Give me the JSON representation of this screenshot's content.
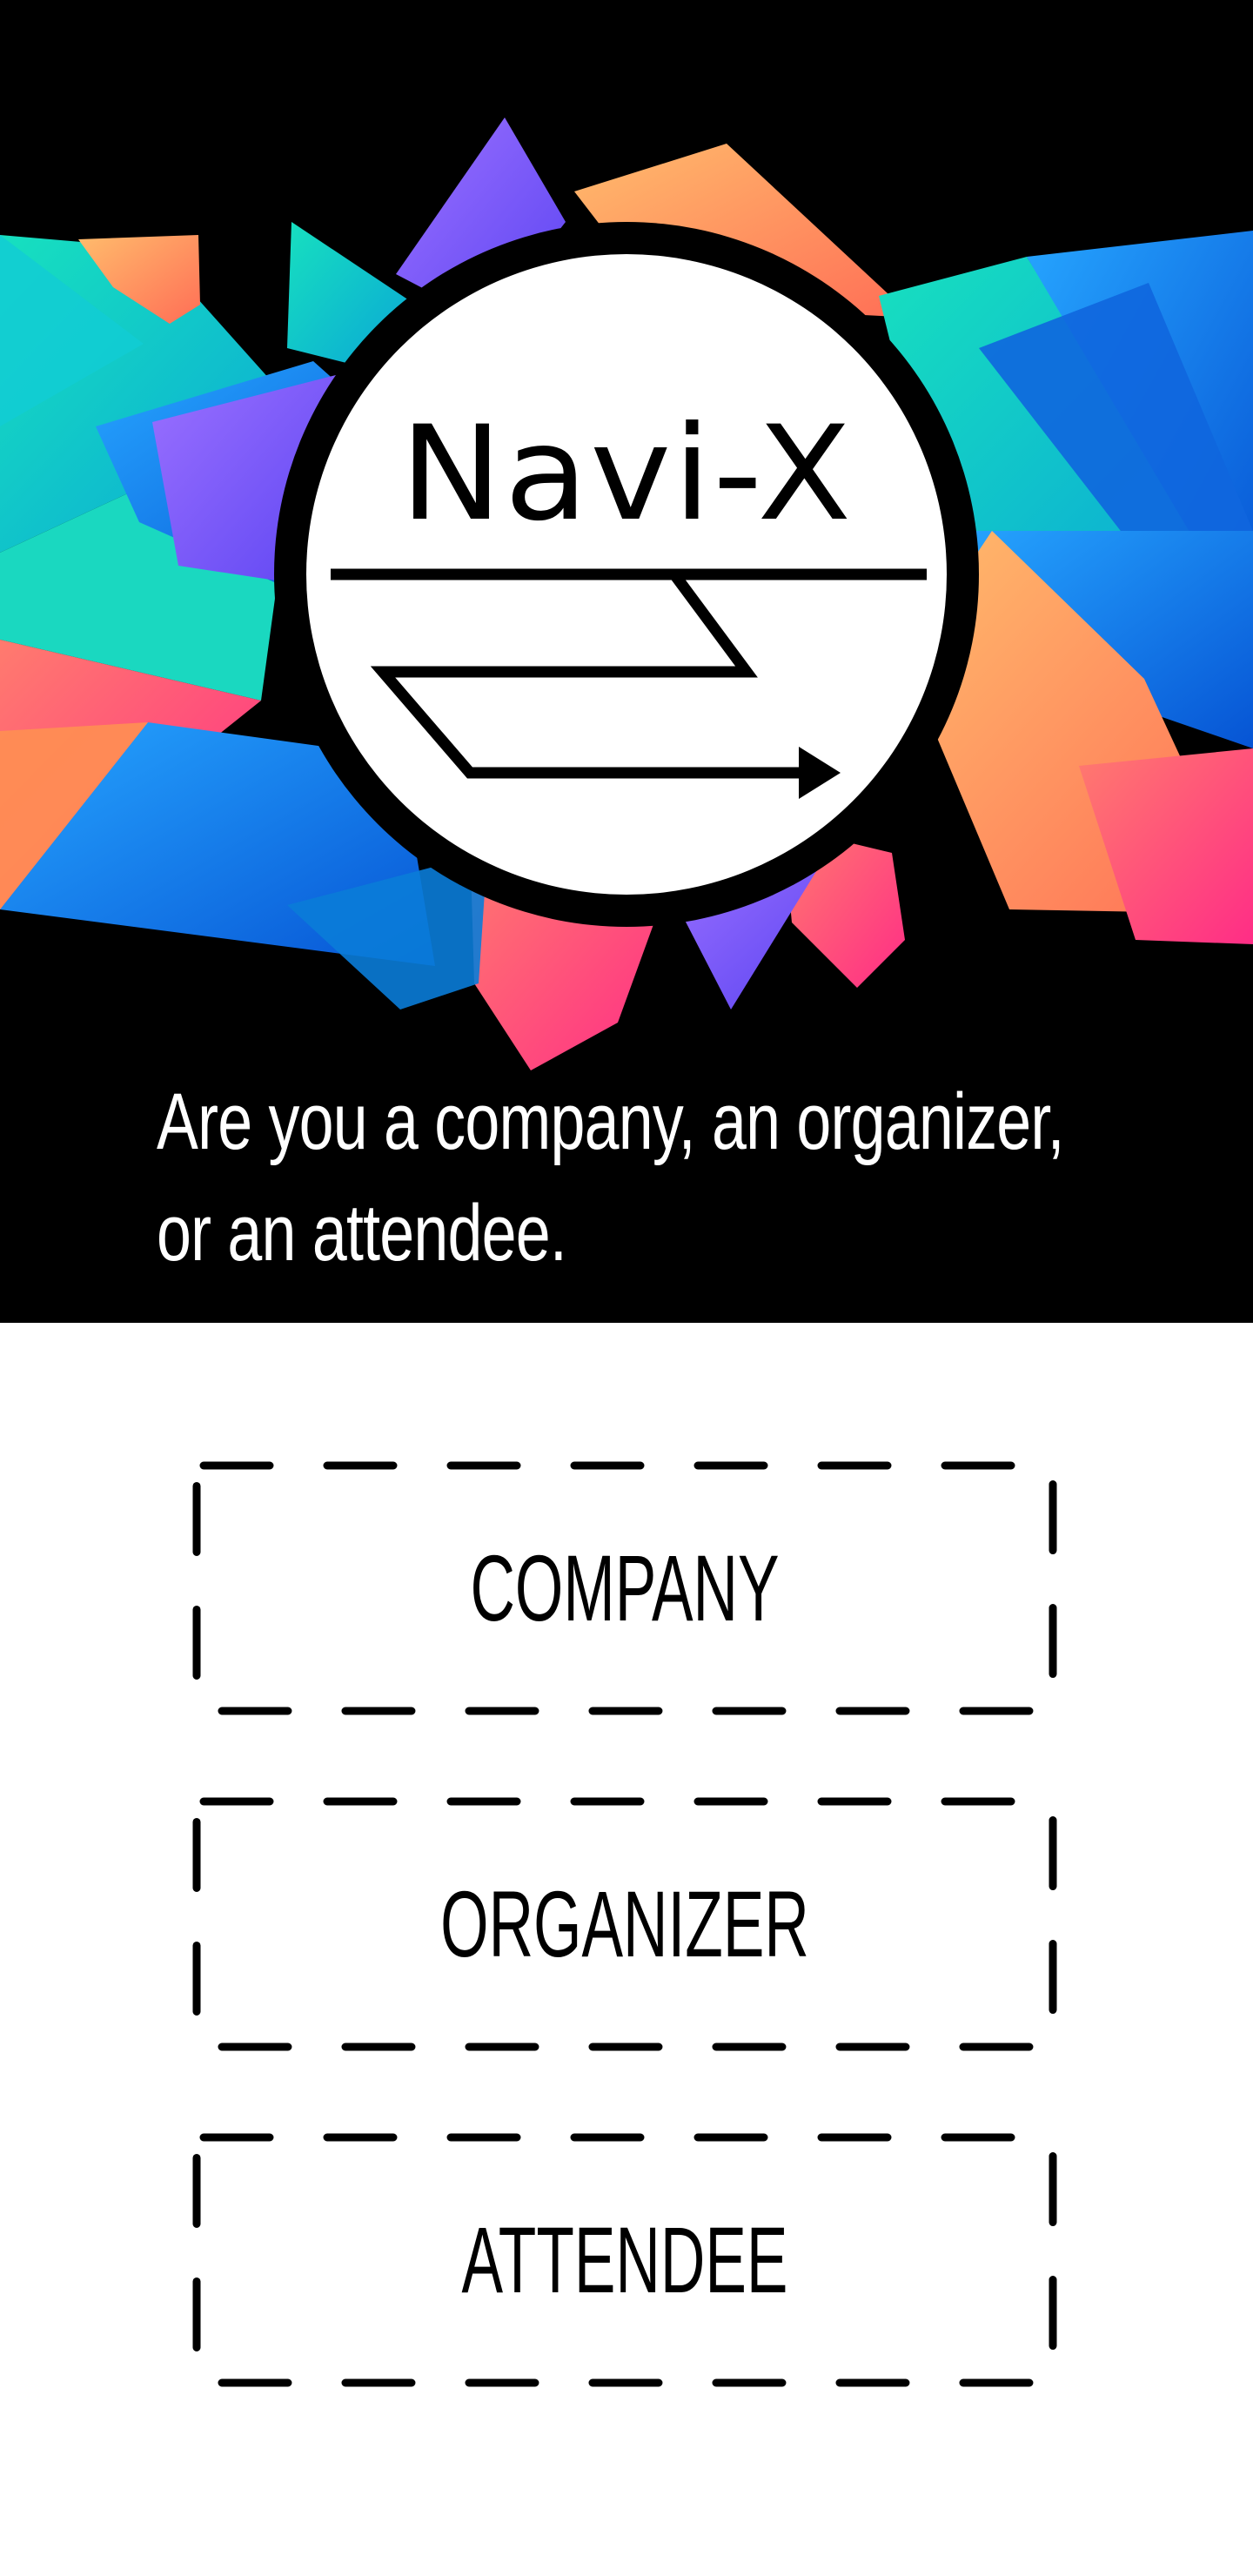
{
  "logo": {
    "text": "Navi-X",
    "icon": "navigation-route-arrow-icon"
  },
  "header": {
    "prompt": "Are you a company, an organizer, or an attendee."
  },
  "choices": [
    {
      "label": "COMPANY"
    },
    {
      "label": "ORGANIZER"
    },
    {
      "label": "ATTENDEE"
    }
  ],
  "colors": {
    "hero_background": "#000000",
    "page_background": "#ffffff",
    "text_light": "#ffffff",
    "text_dark": "#000000",
    "teal": "#14d9c3",
    "blue": "#1f8cf0",
    "purple": "#7a5cff",
    "orange": "#ff9a5a",
    "pink": "#ff4f86"
  }
}
